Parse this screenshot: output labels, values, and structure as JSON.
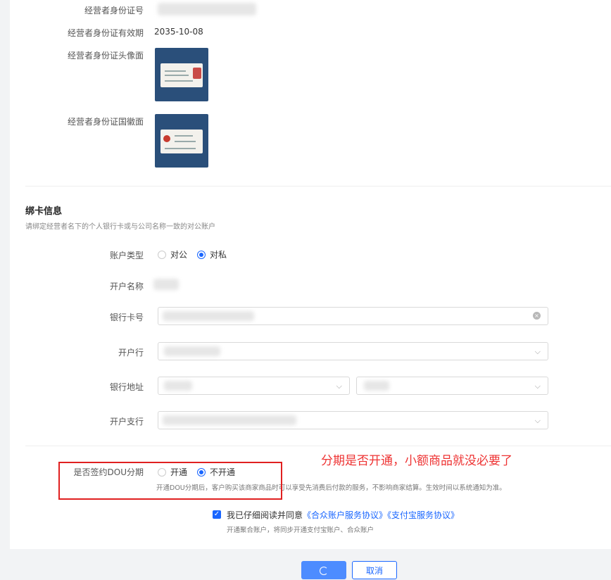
{
  "operator": {
    "id_number_label": "经营者身份证号",
    "id_expiry_label": "经营者身份证有效期",
    "id_expiry_value": "2035-10-08",
    "id_front_label": "经营者身份证头像面",
    "id_back_label": "经营者身份证国徽面"
  },
  "bank": {
    "title": "绑卡信息",
    "subtitle": "请绑定经营者名下的个人银行卡或与公司名称一致的对公账户",
    "account_type_label": "账户类型",
    "account_type_options": [
      "对公",
      "对私"
    ],
    "account_type_selected": "对私",
    "account_name_label": "开户名称",
    "card_number_label": "银行卡号",
    "bank_label": "开户行",
    "bank_address_label": "银行地址",
    "branch_label": "开户支行"
  },
  "dou": {
    "label": "是否签约DOU分期",
    "options": [
      "开通",
      "不开通"
    ],
    "selected": "不开通",
    "hint": "开通DOU分期后，客户购买该商家商品时可以享受先消费后付款的服务，不影响商家结算。生效时间以系统通知为准。"
  },
  "annotation": "分期是否开通，小额商品就没必要了",
  "agreement": {
    "text": "我已仔细阅读并同意",
    "link1": "《合众账户服务协议》",
    "link2": "《支付宝服务协议》",
    "sub": "开通聚合账户，将同步开通支付宝账户、合众账户"
  },
  "footer": {
    "cancel_label": "取消",
    "confirm_label": ""
  },
  "colors": {
    "accent": "#1966ff",
    "annotation_red": "#e02020"
  }
}
